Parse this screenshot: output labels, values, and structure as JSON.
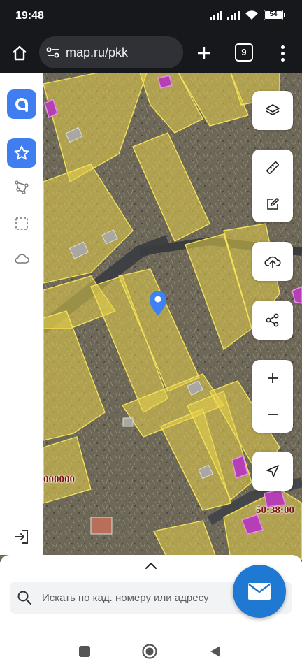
{
  "status_bar": {
    "time": "19:48",
    "battery": "54"
  },
  "browser": {
    "url": "map.ru/pkk",
    "tab_count": "9"
  },
  "map": {
    "cadastral_labels": [
      "000000",
      "50:38:00"
    ]
  },
  "sidebar": {
    "items": [
      {
        "icon": "app-logo-icon"
      },
      {
        "icon": "star-icon",
        "active": true
      },
      {
        "icon": "polygon-draw-icon"
      },
      {
        "icon": "select-area-icon"
      },
      {
        "icon": "cloud-icon"
      },
      {
        "icon": "login-icon"
      }
    ]
  },
  "controls": {
    "icons": [
      "layers-icon",
      "ruler-icon",
      "edit-icon",
      "upload-icon",
      "share-icon",
      "zoom-in-icon",
      "zoom-out-icon",
      "locate-icon"
    ]
  },
  "search": {
    "placeholder": "Искать по кад. номеру или адресу"
  },
  "colors": {
    "accent": "#3f7df1",
    "parcel_fill": "#e8d24a",
    "parcel_border": "#f2e35a",
    "marker": "#3e82f2",
    "highlight": "#b540b5"
  }
}
